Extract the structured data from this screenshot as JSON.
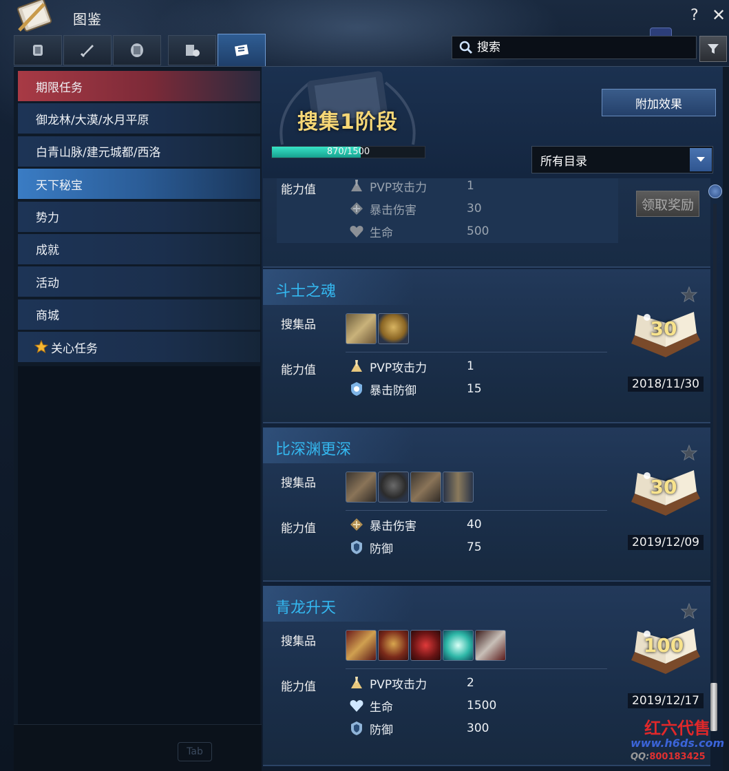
{
  "window": {
    "title": "图鉴",
    "help": "?",
    "close": "✕"
  },
  "tabs": [
    {
      "icon": "armor-tab-icon"
    },
    {
      "icon": "sword-tab-icon"
    },
    {
      "icon": "shield-tab-icon"
    },
    {
      "icon": "gear-map-tab-icon"
    },
    {
      "icon": "scroll-tab-icon",
      "active": true
    }
  ],
  "search": {
    "placeholder": "搜索",
    "value": ""
  },
  "sidebar": {
    "items": [
      {
        "label": "期限任务",
        "state": "highlight-red"
      },
      {
        "label": "御龙林/大漠/水月平原"
      },
      {
        "label": "白青山脉/建元城都/西洛"
      },
      {
        "label": "天下秘宝",
        "state": "selected"
      },
      {
        "label": "势力"
      },
      {
        "label": "成就"
      },
      {
        "label": "活动"
      },
      {
        "label": "商城"
      },
      {
        "label": "关心任务",
        "icon": "star-icon"
      }
    ]
  },
  "header": {
    "stage_title": "搜集1阶段",
    "progress_text": "870/1500",
    "progress_current": 870,
    "progress_max": 1500,
    "bonus_button": "附加效果",
    "category_dropdown": "所有目录",
    "claim_button": "领取奖励"
  },
  "labels": {
    "items": "搜集品",
    "stats": "能力值"
  },
  "partial_card": {
    "stats": [
      {
        "icon": "pvp-attack-icon",
        "name": "PVP攻击力",
        "value": "1"
      },
      {
        "icon": "crit-damage-icon",
        "name": "暴击伤害",
        "value": "30"
      },
      {
        "icon": "heart-icon",
        "name": "生命",
        "value": "500"
      }
    ]
  },
  "cards": [
    {
      "title": "斗士之魂",
      "items": [
        "gold-armor",
        "gold-helmet"
      ],
      "stats": [
        {
          "icon": "pvp-attack-icon",
          "name": "PVP攻击力",
          "value": "1"
        },
        {
          "icon": "crit-defense-icon",
          "name": "暴击防御",
          "value": "15"
        }
      ],
      "reward": "30",
      "date": "2018/11/30"
    },
    {
      "title": "比深渊更深",
      "items": [
        "dark-armor",
        "dark-helmet",
        "dark-armor-2",
        "dark-robe"
      ],
      "stats": [
        {
          "icon": "crit-damage-icon",
          "name": "暴击伤害",
          "value": "40"
        },
        {
          "icon": "defense-icon",
          "name": "防御",
          "value": "75"
        }
      ],
      "reward": "30",
      "date": "2019/12/09"
    },
    {
      "title": "青龙升天",
      "items": [
        "red-gold-armor",
        "red-helmet",
        "red-wings",
        "teal-box",
        "red-weapon"
      ],
      "stats": [
        {
          "icon": "pvp-attack-icon",
          "name": "PVP攻击力",
          "value": "2"
        },
        {
          "icon": "heart-icon",
          "name": "生命",
          "value": "1500"
        },
        {
          "icon": "defense-icon",
          "name": "防御",
          "value": "300"
        }
      ],
      "reward": "100",
      "date": "2019/12/17"
    }
  ],
  "footer": {
    "tab_key": "Tab"
  },
  "watermark": {
    "line1": "红六代售",
    "line2": "www.h6ds.com",
    "qq_label": "QQ:",
    "qq_number": "800183425"
  },
  "colors": {
    "accent_blue": "#34b8f0",
    "stage_gold": "#f6d776",
    "progress": "#2fd6bb",
    "red_highlight": "#a83a45"
  }
}
